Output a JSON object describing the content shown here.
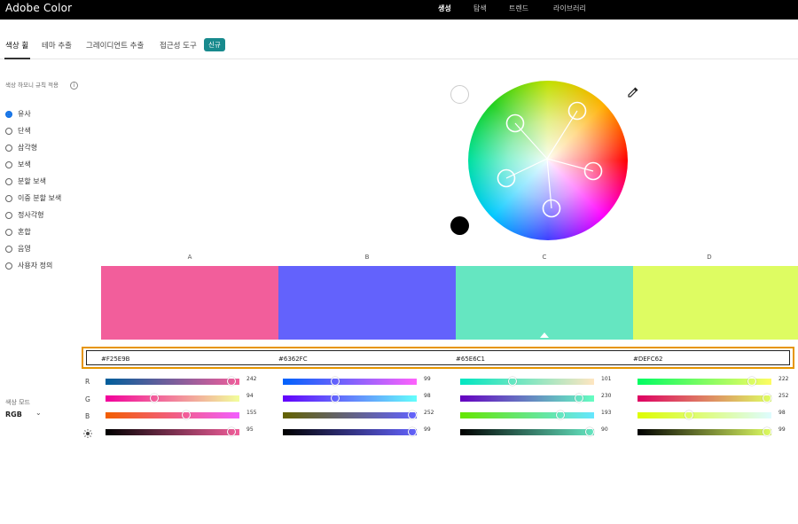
{
  "app": {
    "brand": "Adobe Color",
    "nav": [
      "생성",
      "탐색",
      "트렌드",
      "라이브러리"
    ],
    "nav_active": "생성"
  },
  "tabs": {
    "items": [
      "색상 휠",
      "테마 추출",
      "그레이디언트 추출",
      "접근성 도구"
    ],
    "active": "색상 휠",
    "badge": "신규"
  },
  "harmony": {
    "title": "색상 하모니 규칙 적용",
    "info_icon": "info-icon",
    "rules": [
      "유사",
      "단색",
      "삼각형",
      "보색",
      "분할 보색",
      "이중 분할 보색",
      "정사각형",
      "혼합",
      "음영",
      "사용자 정의"
    ],
    "selected": "유사"
  },
  "wheel": {
    "background_dot": "#FFFFFF",
    "foreground_dot": "#000000",
    "eyedropper_icon": "eyedropper-icon"
  },
  "swatches": [
    {
      "label": "A",
      "hex": "#F25E9B",
      "color": "#F25E9B"
    },
    {
      "label": "B",
      "hex": "#6362FC",
      "color": "#6362FC"
    },
    {
      "label": "C",
      "hex": "#65E6C1",
      "color": "#65E6C1"
    },
    {
      "label": "D",
      "hex": "#DEFC62",
      "color": "#DEFC62"
    }
  ],
  "channels": {
    "labels": [
      "R",
      "G",
      "B"
    ],
    "brightness_icon": "brightness-icon",
    "values": [
      [
        "242",
        "94",
        "155",
        "95"
      ],
      [
        "99",
        "98",
        "252",
        "99"
      ],
      [
        "101",
        "230",
        "193",
        "90"
      ],
      [
        "222",
        "252",
        "98",
        "99"
      ]
    ]
  },
  "color_mode": {
    "title": "색상 모드",
    "value": "RGB"
  }
}
